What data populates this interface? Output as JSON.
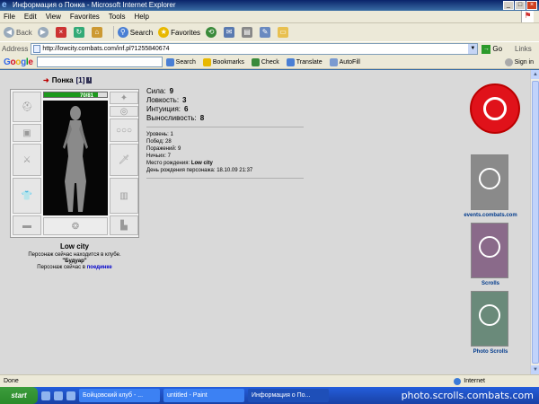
{
  "window": {
    "title": "Информация о Понка - Microsoft Internet Explorer"
  },
  "menu": [
    "File",
    "Edit",
    "View",
    "Favorites",
    "Tools",
    "Help"
  ],
  "toolbar": {
    "back": "Back",
    "search": "Search",
    "favorites": "Favorites"
  },
  "address": {
    "label": "Address",
    "url": "http://lowcity.combats.com/inf.pl?1255840674",
    "go": "Go",
    "links": "Links"
  },
  "google": {
    "logo": "Google",
    "items": [
      "Search",
      "Bookmarks",
      "Check",
      "Translate",
      "AutoFill"
    ],
    "signin": "Sign in"
  },
  "character": {
    "name": "Понка",
    "level": "[1]",
    "hp": "70/81",
    "hp_fraction": 0.86,
    "city": "Low city",
    "club_text": "Персонаж сейчас находится в клубе.",
    "club_name": "\"Будуар\"",
    "duel_prefix": "Персонаж сейчас в",
    "duel_link": "поединке"
  },
  "stats": [
    {
      "label": "Сила:",
      "value": "9"
    },
    {
      "label": "Ловкость:",
      "value": "3"
    },
    {
      "label": "Интуиция:",
      "value": "6"
    },
    {
      "label": "Выносливость:",
      "value": "8"
    }
  ],
  "info": {
    "level": "Уровень: 1",
    "wins": "Побед: 28",
    "losses": "Поражений: 9",
    "draws": "Ничьих: 7",
    "birthplace_label": "Место рождения:",
    "birthplace": "Low city",
    "birthday": "День рождения персонажа: 18.10.09 21:37"
  },
  "ads": [
    {
      "label": "events.combats.com"
    },
    {
      "label": "Scrolls"
    },
    {
      "label": "Photo Scrolls"
    }
  ],
  "status": {
    "text": "Done",
    "zone": "Internet"
  },
  "taskbar": {
    "start": "start",
    "tasks": [
      "Бойцовский клуб - ...",
      "untitled - Paint",
      "Информация о По..."
    ]
  },
  "watermark": "photo.scrolls.combats.com",
  "colors": {
    "hp": "#1d9a1d",
    "link": "#0000cc",
    "title_bg": "#0a246a"
  }
}
